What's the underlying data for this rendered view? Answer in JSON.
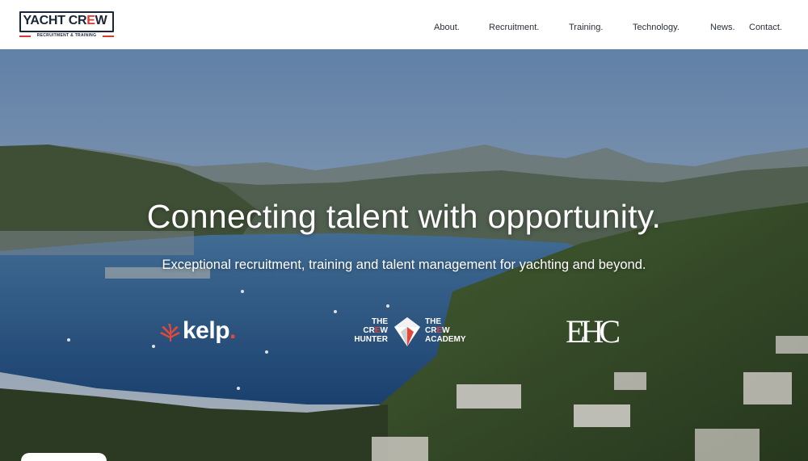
{
  "header": {
    "logo": {
      "name_part1": "YACHT CR",
      "name_accent": "E",
      "name_part2": "W",
      "tagline": "RECRUITMENT & TRAINING"
    },
    "nav": [
      {
        "label": "About."
      },
      {
        "label": "Recruitment."
      },
      {
        "label": "Training."
      },
      {
        "label": "Technology."
      },
      {
        "label": "News."
      },
      {
        "label": "Contact."
      }
    ]
  },
  "hero": {
    "title": "Connecting talent with opportunity.",
    "subtitle": "Exceptional recruitment, training and talent management for yachting and beyond."
  },
  "partners": {
    "kelp": {
      "text": "kelp",
      "dot": "."
    },
    "crew": {
      "left_line1": "THE",
      "left_line2a": "CR",
      "left_line2b": "E",
      "left_line2c": "W",
      "left_line3": "HUNTER",
      "right_line1": "THE",
      "right_line2a": "CR",
      "right_line2b": "E",
      "right_line2c": "W",
      "right_line3": "ACADEMY"
    },
    "ehc": {
      "text": "EHC"
    }
  },
  "colors": {
    "brand_navy": "#1c2535",
    "brand_red": "#d8392e",
    "sky_top": "#7a9cc4",
    "sea": "#2f5a8c"
  }
}
